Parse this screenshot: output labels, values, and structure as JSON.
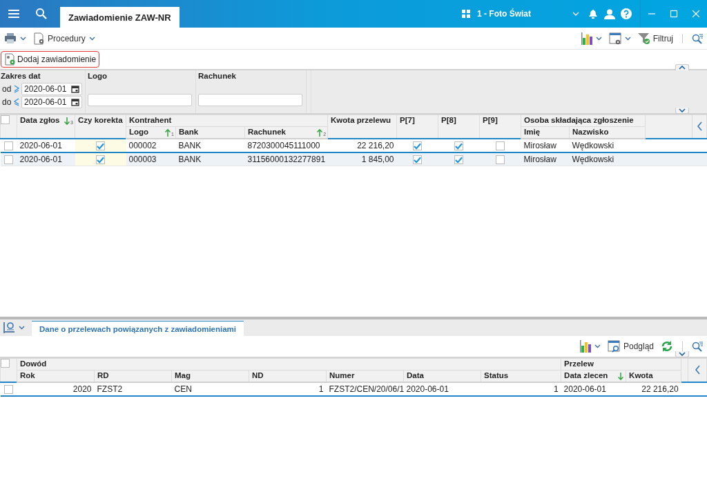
{
  "title_bar": {
    "tabs": [
      {
        "label": "Zawiadomienie ZAW-NR",
        "selected": true
      }
    ],
    "company": "1 - Foto Świat"
  },
  "toolbar": {
    "procedures": "Procedury",
    "filter": "Filtruj"
  },
  "action_button": {
    "label": "Dodaj zawiadomienie",
    "highlighted": true
  },
  "filters": {
    "date_range": {
      "label": "Zakres dat",
      "from_label": "od",
      "from": "2020-06-01",
      "to_label": "do",
      "to": "2020-06-01"
    },
    "fields": [
      {
        "label": "Logo"
      },
      {
        "label": "Rachunek"
      }
    ]
  },
  "grid": {
    "columns": [
      {
        "label": "Data zgłos",
        "kind": "text",
        "sort": {
          "descending": true,
          "order": "3"
        }
      },
      {
        "label": "Czy korekta",
        "kind": "check"
      },
      {
        "label": "Kontrahent",
        "colspan": 3,
        "children": [
          {
            "label": "Logo",
            "kind": "text",
            "sort": {
              "descending": false,
              "order": "1"
            }
          },
          {
            "label": "Bank",
            "kind": "text"
          },
          {
            "label": "Rachunek",
            "kind": "text",
            "sort": {
              "descending": false,
              "order": "2"
            }
          }
        ]
      },
      {
        "label": "Kwota przelewu",
        "kind": "number"
      },
      {
        "label": "P[7]",
        "kind": "check"
      },
      {
        "label": "P[8]",
        "kind": "check"
      },
      {
        "label": "P[9]",
        "kind": "check"
      },
      {
        "label": "Osoba składająca zgłoszenie",
        "colspan": 2,
        "children": [
          {
            "label": "Imię",
            "kind": "text"
          },
          {
            "label": "Nazwisko",
            "kind": "text"
          }
        ]
      }
    ],
    "all_checked": false,
    "rows": [
      {
        "checked": false,
        "focused": true,
        "cells": [
          "2020-06-01",
          true,
          "000002",
          "BANK",
          "8720300045111000",
          "22 216,20",
          true,
          true,
          false,
          "Mirosław",
          "Wędkowski"
        ]
      },
      {
        "checked": false,
        "focused": false,
        "cells": [
          "2020-06-01",
          true,
          "000003",
          "BANK",
          "31156000132277891",
          "1 845,00",
          true,
          true,
          false,
          "Mirosław",
          "Wędkowski"
        ]
      }
    ]
  },
  "detail": {
    "tabs": [
      {
        "label": "Dane o przelewach powiązanych z zawiadomieniami",
        "selected": true
      }
    ],
    "preview": "Podgląd",
    "grid": {
      "columns": [
        {
          "label": "Dowód",
          "colspan": 7,
          "children": [
            {
              "label": "Rok",
              "kind": "number"
            },
            {
              "label": "RD",
              "kind": "text"
            },
            {
              "label": "Mag",
              "kind": "text"
            },
            {
              "label": "ND",
              "kind": "number"
            },
            {
              "label": "Numer",
              "kind": "text"
            },
            {
              "label": "Data",
              "kind": "text"
            },
            {
              "label": "Status",
              "kind": "number"
            }
          ]
        },
        {
          "label": "Przelew",
          "colspan": 2,
          "children": [
            {
              "label": "Data zlecen",
              "kind": "text",
              "sort": {
                "descending": true
              }
            },
            {
              "label": "Kwota",
              "kind": "number"
            }
          ]
        }
      ],
      "all_checked": false,
      "rows": [
        {
          "checked": false,
          "focused": true,
          "cells": [
            "2020",
            "FZST2",
            "CEN",
            "1",
            "FZST2/CEN/20/06/1",
            "2020-06-01",
            "1",
            "2020-06-01",
            "22 216,20"
          ]
        }
      ]
    }
  }
}
